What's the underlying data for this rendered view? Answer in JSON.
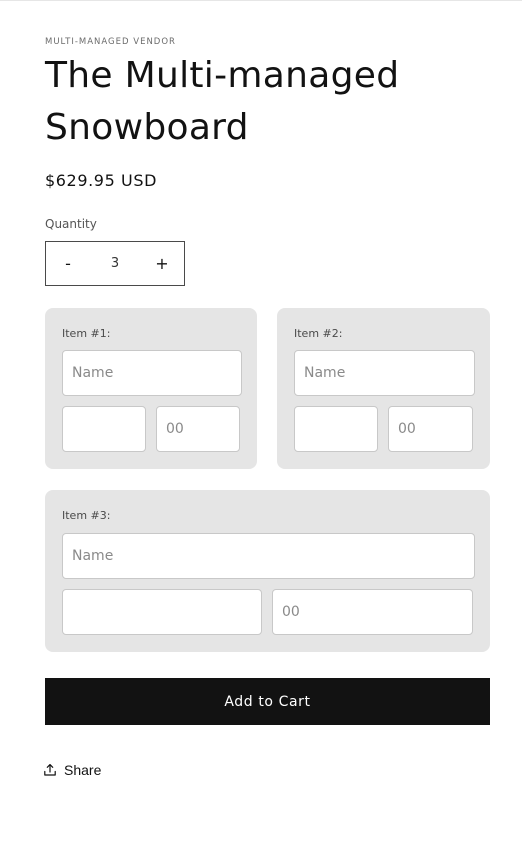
{
  "product": {
    "vendor": "MULTI-MANAGED VENDOR",
    "title": "The Multi-managed Snowboard",
    "price": "$629.95 USD"
  },
  "quantity": {
    "label": "Quantity",
    "decrement": "-",
    "value": "3",
    "increment": "+"
  },
  "items": [
    {
      "label": "Item #1:",
      "name_placeholder": "Name",
      "field2_value": "",
      "field3_placeholder": "00"
    },
    {
      "label": "Item #2:",
      "name_placeholder": "Name",
      "field2_value": "",
      "field3_placeholder": "00"
    },
    {
      "label": "Item #3:",
      "name_placeholder": "Name",
      "field2_value": "",
      "field3_placeholder": "00"
    }
  ],
  "actions": {
    "add_to_cart": "Add to Cart",
    "share": "Share"
  },
  "icons": {
    "share": "share-icon"
  }
}
